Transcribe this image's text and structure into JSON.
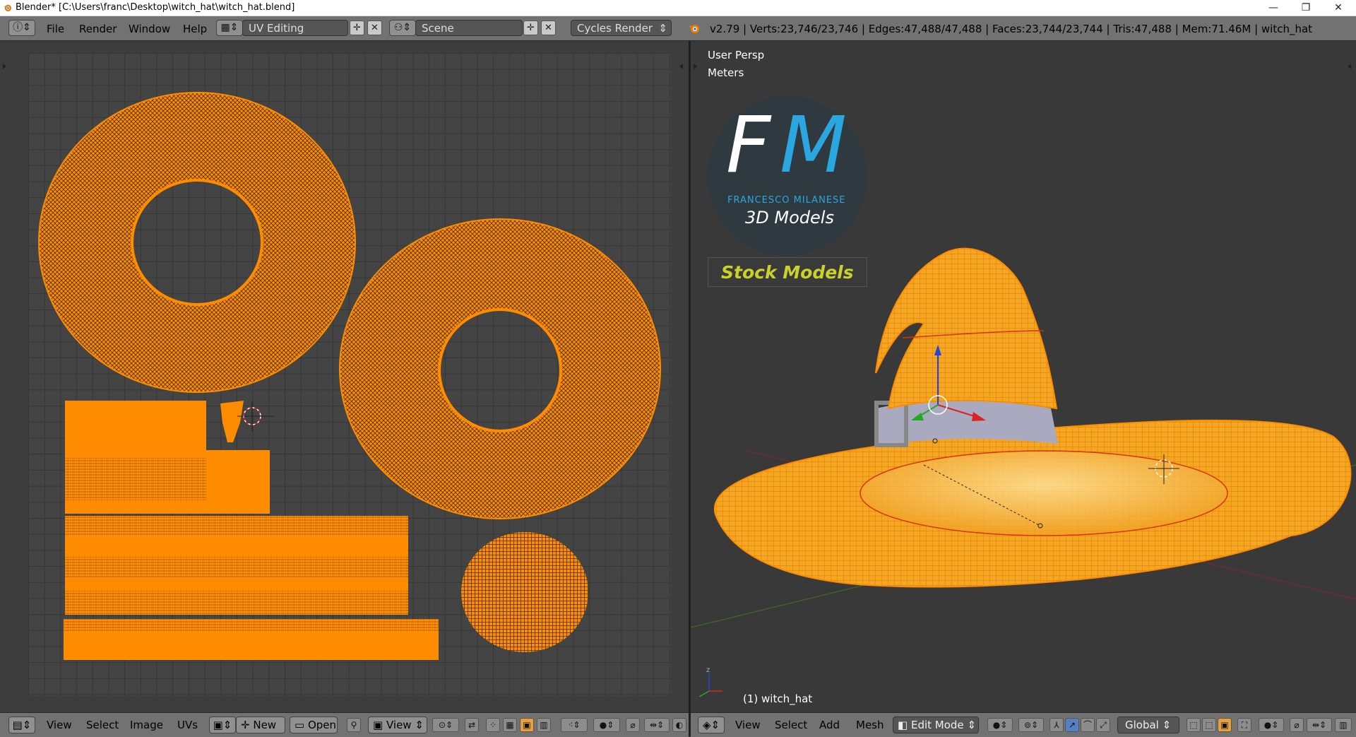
{
  "window": {
    "title": "Blender* [C:\\Users\\franc\\Desktop\\witch_hat\\witch_hat.blend]",
    "controls": [
      "—",
      "❐",
      "✕"
    ]
  },
  "info_header": {
    "menus": [
      "File",
      "Render",
      "Window",
      "Help"
    ],
    "layout_name": "UV Editing",
    "scene_name": "Scene",
    "render_engine": "Cycles Render",
    "stats": "v2.79 | Verts:23,746/23,746 | Edges:47,488/47,488 | Faces:23,744/23,744 | Tris:47,488 | Mem:71.46M | witch_hat"
  },
  "uv_editor": {
    "header_menus": [
      "View",
      "Select",
      "Image",
      "UVs"
    ],
    "new_label": "New",
    "open_label": "Open",
    "view_label": "View"
  },
  "viewport": {
    "view_name": "User Persp",
    "units": "Meters",
    "object_label": "(1) witch_hat",
    "header_menus": [
      "View",
      "Select",
      "Add",
      "Mesh"
    ],
    "mode": "Edit Mode",
    "orientation": "Global"
  },
  "watermark": {
    "initials_f": "F",
    "initials_m": "M",
    "author": "FRANCESCO MILANESE",
    "subtitle": "3D Models",
    "banner": "Stock Models"
  },
  "colors": {
    "uv_orange": "#ff8c00",
    "background": "#3d3d3d",
    "header": "#727272",
    "logo_blue": "#2aa6e0",
    "banner_yellow": "#c8d22a"
  }
}
